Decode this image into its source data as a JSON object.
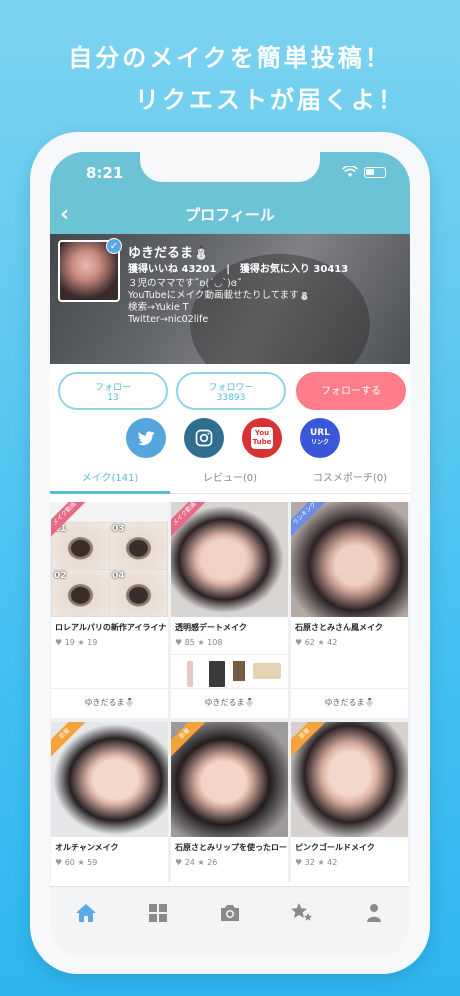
{
  "promo": {
    "line1": "自分のメイクを簡単投稿！",
    "line2": "リクエストが届くよ！"
  },
  "status": {
    "time": "8:21"
  },
  "header": {
    "title": "プロフィール"
  },
  "profile": {
    "name": "ゆきだるま⛄",
    "stats": "獲得いいね 43201　|　獲得お気に入り 30413",
    "bio": [
      "３児のママです˚ʚ(´◡`)ɞ˚",
      "YouTubeにメイク動画載せたりしてます⛄",
      "検索→Yukie T",
      "Twitter→nic02life"
    ]
  },
  "actions": {
    "follow_label": "フォロー",
    "follow_count": "13",
    "followers_label": "フォロワー",
    "followers_count": "33893",
    "do_follow": "フォローする"
  },
  "socials": {
    "youtube_label": "You Tube",
    "url_label": "URL",
    "url_sub": "リンク"
  },
  "tabs": [
    "メイク(141)",
    "レビュー(0)",
    "コスメポーチ(0)"
  ],
  "cards": [
    {
      "title": "ロレアルパリの新作アイライナー",
      "likes": "19",
      "favs": "19",
      "author": "ゆきだるま⛄",
      "ribbon": "メイク動画",
      "labels": [
        "01",
        "03",
        "02",
        "04"
      ]
    },
    {
      "title": "透明感デートメイク",
      "likes": "85",
      "favs": "108",
      "author": "ゆきだるま⛄",
      "ribbon": "メイク動画"
    },
    {
      "title": "石原さとみさん風メイク",
      "likes": "62",
      "favs": "42",
      "author": "ゆきだるま⛄",
      "ribbon": "ランキング"
    },
    {
      "title": "オルチャンメイク",
      "likes": "60",
      "favs": "59",
      "ribbon": "新着"
    },
    {
      "title": "石原さとみリップを使ったローズ…",
      "likes": "24",
      "favs": "26",
      "ribbon": "新着"
    },
    {
      "title": "ピンクゴールドメイク",
      "likes": "32",
      "favs": "42",
      "ribbon": "新着"
    }
  ],
  "colors": {
    "header": "#6cc3d6",
    "accent": "#5cbad8",
    "follow_button": "#ff7c8a",
    "twitter": "#55a6dc",
    "instagram": "#2f6e8f",
    "youtube": "#d93232",
    "url": "#3b57d9"
  },
  "tabbar": [
    "home-icon",
    "grid-icon",
    "camera-icon",
    "favorites-icon",
    "profile-icon"
  ]
}
